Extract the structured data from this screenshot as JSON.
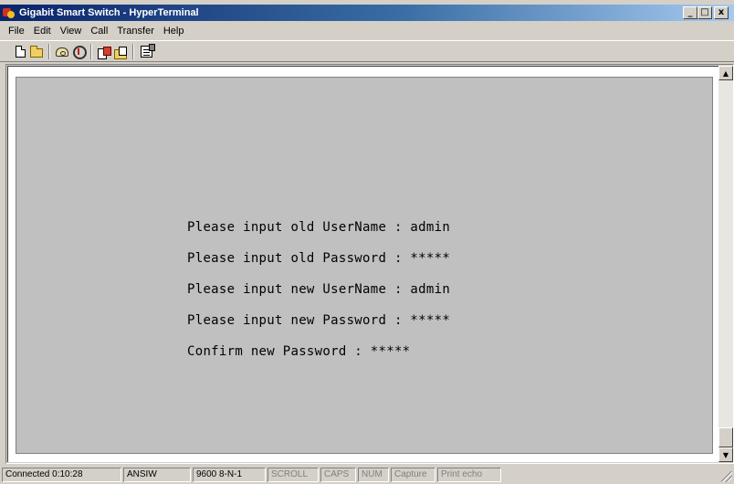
{
  "window": {
    "title": "Gigabit Smart Switch - HyperTerminal",
    "controls": {
      "minimize": "_",
      "maximize": "□",
      "close": "x"
    }
  },
  "menu": [
    "File",
    "Edit",
    "View",
    "Call",
    "Transfer",
    "Help"
  ],
  "toolbar": {
    "buttons": [
      "new-document-icon",
      "open-folder-icon",
      "call-phone-icon",
      "disconnect-icon",
      "send-file-icon",
      "receive-file-icon",
      "properties-icon"
    ]
  },
  "terminal": {
    "background": "#c0c0c0",
    "lines": [
      "Please input old UserName : admin",
      "Please input old Password : *****",
      "Please input new UserName : admin",
      "Please input new Password : *****",
      "Confirm new Password : *****"
    ]
  },
  "scrollbar": {
    "up": "▲",
    "down": "▼"
  },
  "statusbar": {
    "connected": "Connected 0:10:28",
    "emulation": "ANSIW",
    "settings": "9600 8-N-1",
    "scroll": "SCROLL",
    "caps": "CAPS",
    "num": "NUM",
    "capture": "Capture",
    "print_echo": "Print echo"
  }
}
